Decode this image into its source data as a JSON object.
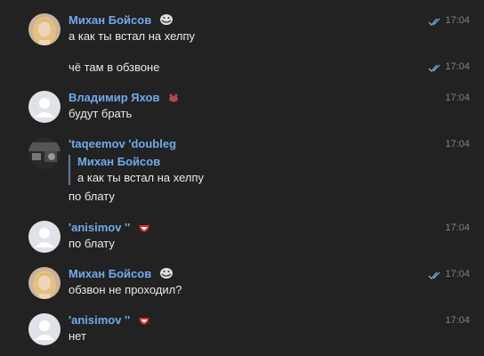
{
  "messages": [
    {
      "author": "Михан Бойсов",
      "text": "а как ты встал на хелпу",
      "time": "17:04",
      "read": true,
      "badge": "troll-face-emoji",
      "avatar": "photo-blonde-woman"
    },
    {
      "text": "чё там в обзвоне",
      "time": "17:04",
      "read": true
    },
    {
      "author": "Владимир Яхов",
      "text": "будут брать",
      "time": "17:04",
      "badge": "small-creature-emoji",
      "avatar": "default-avatar"
    },
    {
      "author": "'taqeemov 'doubleg",
      "quote_author": "Михан Бойсов",
      "quote_text": "а как ты встал на хелпу",
      "text": "по блату",
      "time": "17:04",
      "avatar": "photo-dark"
    },
    {
      "author": "'anisimov ''",
      "text": "по блату",
      "time": "17:04",
      "badge": "spartak-logo",
      "avatar": "default-avatar"
    },
    {
      "author": "Михан Бойсов",
      "text": "обзвон не проходил?",
      "time": "17:04",
      "read": true,
      "badge": "troll-face-emoji",
      "avatar": "photo-blonde-woman"
    },
    {
      "author": "'anisimov ''",
      "text": "нет",
      "time": "17:04",
      "badge": "spartak-logo",
      "avatar": "default-avatar"
    }
  ],
  "colors": {
    "background": "#222222",
    "author": "#71aaeb",
    "text": "#e9e9e9",
    "time": "#828282",
    "read_ticks": "#71aaeb"
  }
}
